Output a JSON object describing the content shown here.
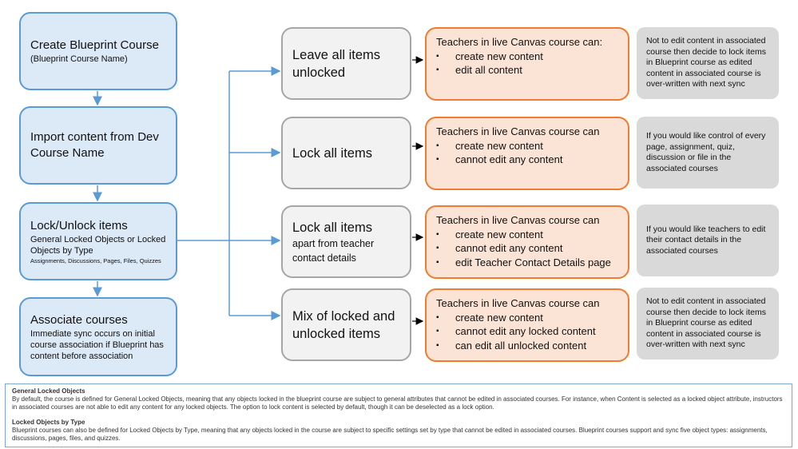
{
  "left_column": [
    {
      "title": "Create Blueprint Course",
      "sub": "(Blueprint Course Name)"
    },
    {
      "title": "Import content from Dev Course Name"
    },
    {
      "title": "Lock/Unlock items",
      "sub": "General Locked Objects or Locked Objects by Type",
      "detail": "Assignments, Discussions, Pages, Files, Quizzes"
    },
    {
      "title": "Associate courses",
      "sub": "Immediate sync occurs on initial course association if Blueprint has content before association"
    }
  ],
  "options": [
    {
      "title": "Leave all items unlocked",
      "heading": "Teachers in live Canvas course can:",
      "bullets": [
        "create new content",
        "edit all content"
      ],
      "note": "Not to edit content in associated course then decide to lock items in Blueprint course as edited content in associated course is over-written with next sync"
    },
    {
      "title": "Lock all items",
      "heading": "Teachers in live Canvas course can",
      "bullets": [
        "create new content",
        "cannot edit any content"
      ],
      "note": "If you would like control of every page, assignment, quiz, discussion or file in the associated courses"
    },
    {
      "title": "Lock all items",
      "sub": "apart from teacher contact details",
      "heading": "Teachers in live Canvas course can",
      "bullets": [
        "create new content",
        "cannot edit any content",
        "edit Teacher Contact Details page"
      ],
      "note": "If you would like teachers to edit their contact details in the associated courses"
    },
    {
      "title": "Mix of locked and unlocked items",
      "heading": "Teachers in live Canvas course can",
      "bullets": [
        "create new content",
        "cannot edit any locked content",
        "can edit all unlocked content"
      ],
      "note": "Not to edit content in associated course then decide to lock items in Blueprint course as edited content in associated course is over-written with next sync"
    }
  ],
  "bullet_glyph": "▪",
  "footnote": {
    "h1": "General Locked Objects",
    "p1": "By default, the course is defined for General Locked Objects, meaning that any objects locked in the blueprint course are subject to general attributes that cannot be edited in associated courses. For instance, when Content is selected as a locked object attribute, instructors in associated courses are not able to edit any content for any locked objects. The option to lock content is selected by default, though it can be deselected as a lock option.",
    "h2": "Locked Objects by Type",
    "p2": "Blueprint courses can also be defined for Locked Objects by Type, meaning that any objects locked in the course are subject to specific settings set by type that cannot be edited in associated courses. Blueprint courses support and sync five object types: assignments, discussions, pages, files, and quizzes."
  },
  "colors": {
    "blue_fill": "#dce9f6",
    "blue_border": "#5b9bd5",
    "orange_fill": "#fbe4d5",
    "orange_border": "#ed7d31",
    "gray": "#d9d9d9"
  }
}
